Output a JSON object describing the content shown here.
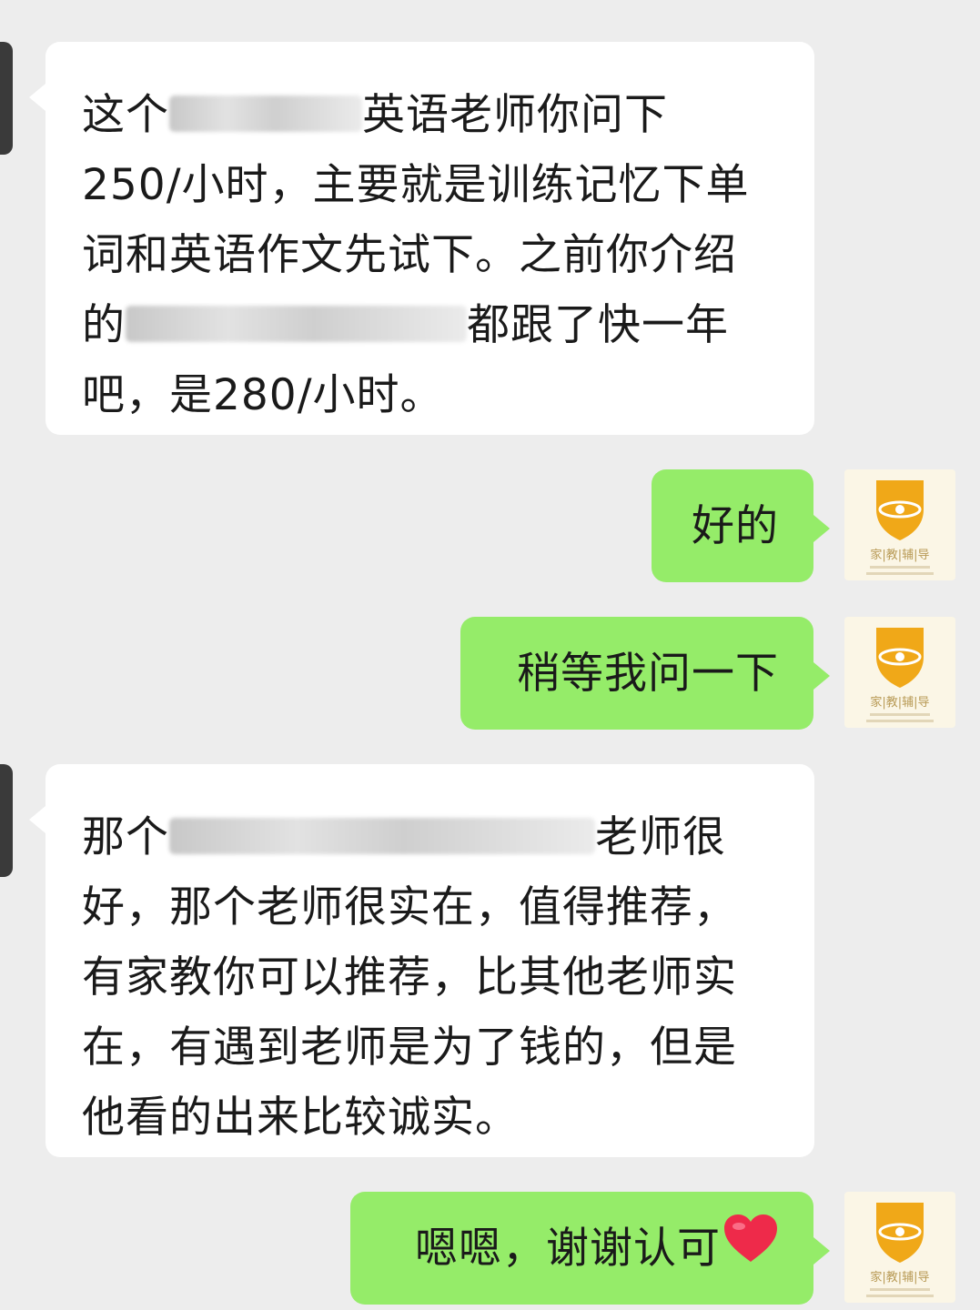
{
  "messages": [
    {
      "side": "left",
      "lines": [
        {
          "before": "这个",
          "after": "英语老师你问下"
        },
        {
          "text": "250/小时，主要就是训练记忆下单"
        },
        {
          "text": "词和英语作文先试下。之前你介绍"
        },
        {
          "before": "的",
          "after": "都跟了快一年"
        },
        {
          "text": "吧，是280/小时。"
        }
      ]
    },
    {
      "side": "right",
      "text": "好的"
    },
    {
      "side": "right",
      "text": "稍等我问一下"
    },
    {
      "side": "left",
      "lines": [
        {
          "before": "那个",
          "after": "老师很"
        },
        {
          "text": "好，那个老师很实在，值得推荐，"
        },
        {
          "text": "有家教你可以推荐，比其他老师实"
        },
        {
          "text": "在，有遇到老师是为了钱的，但是"
        },
        {
          "text": "他看的出来比较诚实。"
        }
      ]
    },
    {
      "side": "right",
      "text": "嗯嗯，谢谢认可",
      "emoji": "heart-icon"
    }
  ],
  "avatar": {
    "badge_text": "家|教|辅|导",
    "icon": "bee-shield-icon",
    "badge_color": "#f0a818"
  },
  "colors": {
    "background": "#ededed",
    "incoming_bubble": "#ffffff",
    "outgoing_bubble": "#95ec69",
    "heart": "#ee2a4a"
  }
}
